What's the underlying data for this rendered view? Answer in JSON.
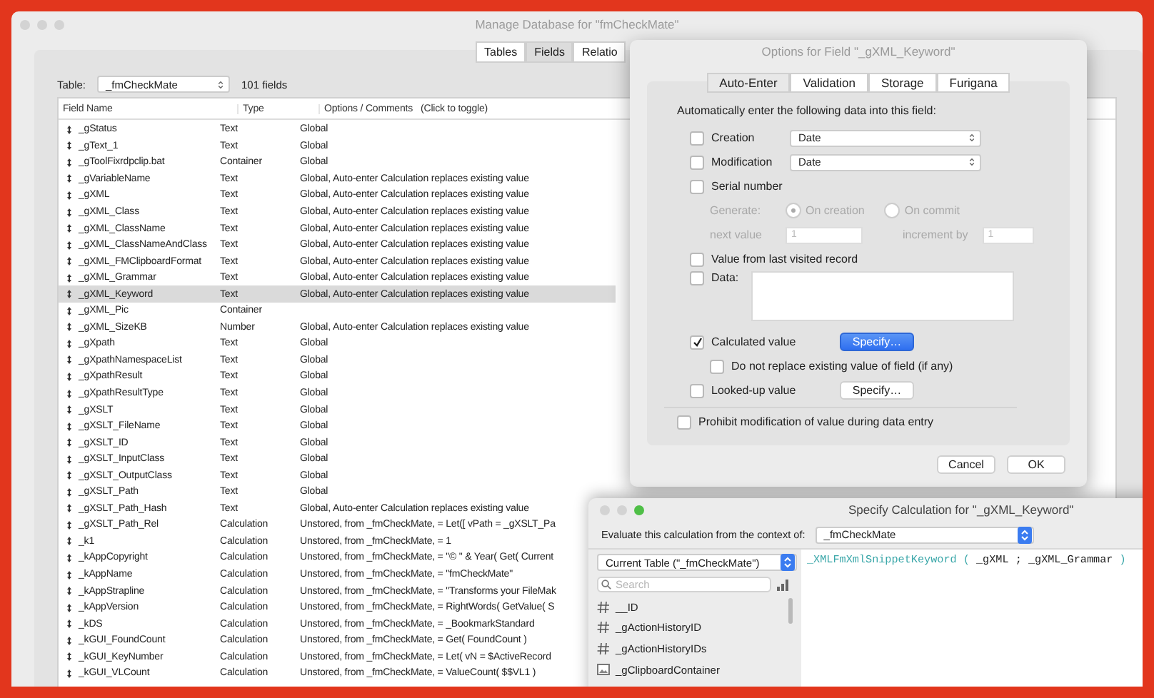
{
  "window": {
    "title": "Manage Database for \"fmCheckMate\""
  },
  "tabs": [
    {
      "label": "Tables",
      "selected": false
    },
    {
      "label": "Fields",
      "selected": true
    },
    {
      "label": "Relatio",
      "selected": false
    }
  ],
  "table_selector": {
    "label": "Table:",
    "value": "_fmCheckMate",
    "count": "101 fields"
  },
  "field_list": {
    "columns": [
      "Field Name",
      "Type",
      "Options / Comments   (Click to toggle)"
    ],
    "rows": [
      {
        "name": "_gStatus",
        "type": "Text",
        "options": "Global",
        "selected": false
      },
      {
        "name": "_gText_1",
        "type": "Text",
        "options": "Global",
        "selected": false
      },
      {
        "name": "_gToolFixrdpclip.bat",
        "type": "Container",
        "options": "Global",
        "selected": false
      },
      {
        "name": "_gVariableName",
        "type": "Text",
        "options": "Global, Auto-enter Calculation replaces existing value",
        "selected": false
      },
      {
        "name": "_gXML",
        "type": "Text",
        "options": "Global, Auto-enter Calculation replaces existing value",
        "selected": false
      },
      {
        "name": "_gXML_Class",
        "type": "Text",
        "options": "Global, Auto-enter Calculation replaces existing value",
        "selected": false
      },
      {
        "name": "_gXML_ClassName",
        "type": "Text",
        "options": "Global, Auto-enter Calculation replaces existing value",
        "selected": false
      },
      {
        "name": "_gXML_ClassNameAndClass",
        "type": "Text",
        "options": "Global, Auto-enter Calculation replaces existing value",
        "selected": false
      },
      {
        "name": "_gXML_FMClipboardFormat",
        "type": "Text",
        "options": "Global, Auto-enter Calculation replaces existing value",
        "selected": false
      },
      {
        "name": "_gXML_Grammar",
        "type": "Text",
        "options": "Global, Auto-enter Calculation replaces existing value",
        "selected": false
      },
      {
        "name": "_gXML_Keyword",
        "type": "Text",
        "options": "Global, Auto-enter Calculation replaces existing value",
        "selected": true
      },
      {
        "name": "_gXML_Pic",
        "type": "Container",
        "selected": false
      },
      {
        "name": "_gXML_SizeKB",
        "type": "Number",
        "options": "Global, Auto-enter Calculation replaces existing value",
        "selected": false
      },
      {
        "name": "_gXpath",
        "type": "Text",
        "options": "Global",
        "selected": false
      },
      {
        "name": "_gXpathNamespaceList",
        "type": "Text",
        "options": "Global",
        "selected": false
      },
      {
        "name": "_gXpathResult",
        "type": "Text",
        "options": "Global",
        "selected": false
      },
      {
        "name": "_gXpathResultType",
        "type": "Text",
        "options": "Global",
        "selected": false
      },
      {
        "name": "_gXSLT",
        "type": "Text",
        "options": "Global",
        "selected": false
      },
      {
        "name": "_gXSLT_FileName",
        "type": "Text",
        "options": "Global",
        "selected": false
      },
      {
        "name": "_gXSLT_ID",
        "type": "Text",
        "options": "Global",
        "selected": false
      },
      {
        "name": "_gXSLT_InputClass",
        "type": "Text",
        "options": "Global",
        "selected": false
      },
      {
        "name": "_gXSLT_OutputClass",
        "type": "Text",
        "options": "Global",
        "selected": false
      },
      {
        "name": "_gXSLT_Path",
        "type": "Text",
        "options": "Global",
        "selected": false
      },
      {
        "name": "_gXSLT_Path_Hash",
        "type": "Text",
        "options": "Global, Auto-enter Calculation replaces existing value",
        "selected": false
      },
      {
        "name": "_gXSLT_Path_Rel",
        "type": "Calculation",
        "options": "Unstored, from _fmCheckMate, = Let([  vPath = _gXSLT_Pa",
        "selected": false
      },
      {
        "name": "_k1",
        "type": "Calculation",
        "options": "Unstored, from _fmCheckMate, = 1",
        "selected": false
      },
      {
        "name": "_kAppCopyright",
        "type": "Calculation",
        "options": "Unstored, from _fmCheckMate, = \"© \" & Year( Get( Current",
        "selected": false
      },
      {
        "name": "_kAppName",
        "type": "Calculation",
        "options": "Unstored, from _fmCheckMate, = \"fmCheckMate\"",
        "selected": false
      },
      {
        "name": "_kAppStrapline",
        "type": "Calculation",
        "options": "Unstored, from _fmCheckMate, = \"Transforms your FileMak",
        "selected": false
      },
      {
        "name": "_kAppVersion",
        "type": "Calculation",
        "options": "Unstored, from _fmCheckMate, = RightWords( GetValue( S",
        "selected": false
      },
      {
        "name": "_kDS",
        "type": "Calculation",
        "options": "Unstored, from _fmCheckMate, = _BookmarkStandard",
        "selected": false
      },
      {
        "name": "_kGUI_FoundCount",
        "type": "Calculation",
        "options": "Unstored, from _fmCheckMate, = Get( FoundCount )",
        "selected": false
      },
      {
        "name": "_kGUI_KeyNumber",
        "type": "Calculation",
        "options": "Unstored, from _fmCheckMate, = Let( vN = $ActiveRecord",
        "selected": false
      },
      {
        "name": "_kGUI_VLCount",
        "type": "Calculation",
        "options": "Unstored, from _fmCheckMate, = ValueCount( $$VL1 )",
        "selected": false
      }
    ]
  },
  "options_dialog": {
    "title": "Options for Field \"_gXML_Keyword\"",
    "tabs": [
      {
        "label": "Auto-Enter",
        "selected": true
      },
      {
        "label": "Validation",
        "selected": false
      },
      {
        "label": "Storage",
        "selected": false
      },
      {
        "label": "Furigana",
        "selected": false
      }
    ],
    "heading": "Automatically enter the following data into this field:",
    "creation": {
      "label": "Creation",
      "checked": false,
      "value": "Date"
    },
    "modification": {
      "label": "Modification",
      "checked": false,
      "value": "Date"
    },
    "serial": {
      "label": "Serial number",
      "checked": false,
      "disabled": true,
      "generate_label": "Generate:",
      "options": [
        {
          "label": "On creation",
          "selected": true
        },
        {
          "label": "On commit",
          "selected": false
        }
      ],
      "next_value_label": "next value",
      "next_value": "1",
      "increment_label": "increment by",
      "increment": "1"
    },
    "last_visited": {
      "label": "Value from last visited record",
      "checked": false
    },
    "data": {
      "label": "Data:",
      "checked": false
    },
    "calculated": {
      "label": "Calculated value",
      "checked": true,
      "button": {
        "label": "Specify…",
        "default": true
      },
      "do_not_replace": {
        "label": "Do not replace existing value of field (if any)",
        "checked": false
      }
    },
    "looked_up": {
      "label": "Looked-up value",
      "checked": false,
      "button": {
        "label": "Specify…",
        "default": false
      }
    },
    "prohibit": {
      "label": "Prohibit modification of value during data entry",
      "checked": false
    },
    "buttons": [
      "Cancel",
      "OK"
    ]
  },
  "calculation_window": {
    "title": "Specify Calculation for \"_gXML_Keyword\"",
    "context_label": "Evaluate this calculation from the context of:",
    "context": "_fmCheckMate",
    "source": "Current Table (\"_fmCheckMate\")",
    "search": {
      "placeholder": "Search"
    },
    "fields": [
      {
        "name": "__ID",
        "kind": "number"
      },
      {
        "name": "_gActionHistoryID",
        "kind": "number"
      },
      {
        "name": "_gActionHistoryIDs",
        "kind": "number"
      },
      {
        "name": "_gClipboardContainer",
        "kind": "container"
      }
    ],
    "formula": [
      {
        "kind": "function",
        "text": "_XMLFmXmlSnippetKeyword ("
      },
      {
        "kind": "field",
        "text": " _gXML ; _gXML_Grammar "
      },
      {
        "kind": "function",
        "text": ")"
      }
    ]
  }
}
